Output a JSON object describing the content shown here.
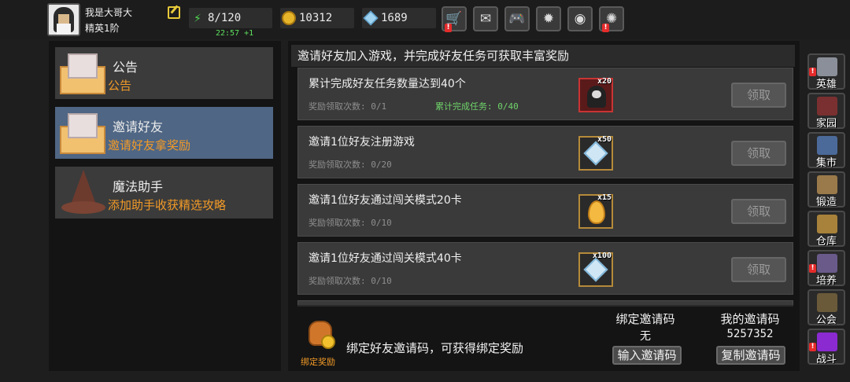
{
  "player": {
    "name": "我是大哥大",
    "rank": "精英1阶"
  },
  "resources": {
    "energy": "8/120",
    "timer": "22:57 +1",
    "coins": "10312",
    "gems": "1689"
  },
  "toolbar": [
    {
      "name": "shop-cart-icon",
      "glyph": "🛒",
      "badge": "!"
    },
    {
      "name": "mail-icon",
      "glyph": "✉",
      "badge": ""
    },
    {
      "name": "gamepad-icon",
      "glyph": "🎮",
      "badge": ""
    },
    {
      "name": "gear-icon",
      "glyph": "✹",
      "badge": ""
    },
    {
      "name": "color-wheel-icon",
      "glyph": "◉",
      "badge": ""
    },
    {
      "name": "fireworks-icon",
      "glyph": "✺",
      "badge": "!"
    }
  ],
  "menu": [
    {
      "title": "公告",
      "sub": "公告"
    },
    {
      "title": "邀请好友",
      "sub": "邀请好友拿奖励"
    },
    {
      "title": "魔法助手",
      "sub": "添加助手收获精选攻略"
    }
  ],
  "main": {
    "header": "邀请好友加入游戏，并完成好友任务可获取丰富奖励",
    "claim_label": "领取",
    "tasks": [
      {
        "name": "累计完成好友任务数量达到40个",
        "count": "奖励领取次数: 0/1",
        "progress": "累计完成任务: 0/40",
        "qty": "x20"
      },
      {
        "name": "邀请1位好友注册游戏",
        "count": "奖励领取次数: 0/20",
        "progress": "",
        "qty": "x50"
      },
      {
        "name": "邀请1位好友通过闯关模式20卡",
        "count": "奖励领取次数: 0/10",
        "progress": "",
        "qty": "x15"
      },
      {
        "name": "邀请1位好友通过闯关模式40卡",
        "count": "奖励领取次数: 0/10",
        "progress": "",
        "qty": "x100"
      }
    ],
    "bottom": {
      "bag_label": "绑定奖励",
      "bind_text": "绑定好友邀请码，可获得绑定奖励",
      "bound_head": "绑定邀请码",
      "bound_value": "无",
      "my_head": "我的邀请码",
      "my_value": "5257352",
      "input_button": "输入邀请码",
      "copy_button": "复制邀请码"
    }
  },
  "rightnav": [
    {
      "label": "英雄",
      "color": "#8a8f99",
      "badge": "!"
    },
    {
      "label": "家园",
      "color": "#7a3030",
      "badge": ""
    },
    {
      "label": "集市",
      "color": "#4b6a9a",
      "badge": ""
    },
    {
      "label": "锻造",
      "color": "#9a7a4a",
      "badge": ""
    },
    {
      "label": "仓库",
      "color": "#a8823a",
      "badge": ""
    },
    {
      "label": "培养",
      "color": "#6a5a8a",
      "badge": "!"
    },
    {
      "label": "公会",
      "color": "#6a5a3a",
      "badge": ""
    },
    {
      "label": "战斗",
      "color": "#8a2ad0",
      "badge": "!"
    }
  ]
}
